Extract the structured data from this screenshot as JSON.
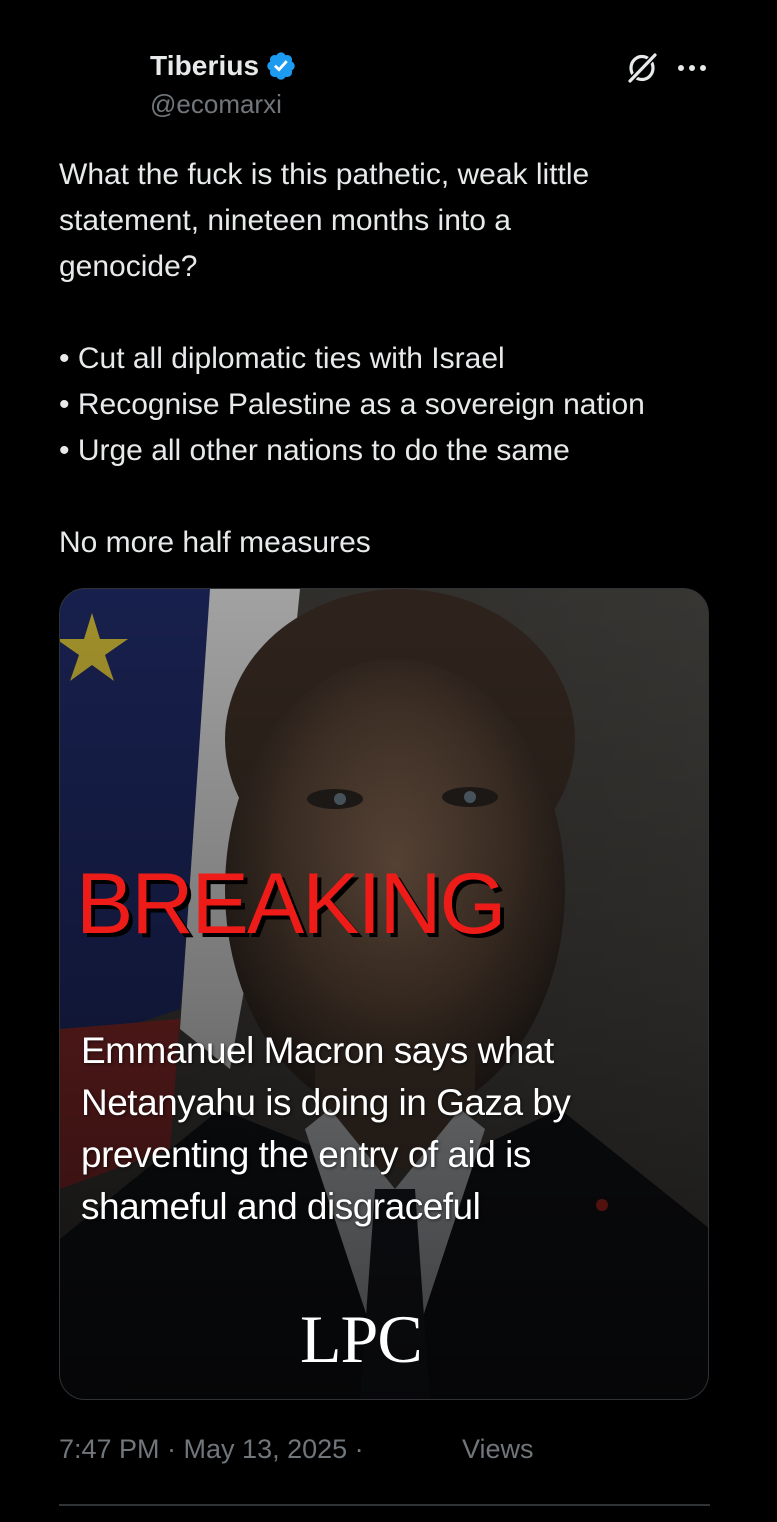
{
  "author": {
    "name": "Tiberius",
    "handle": "@ecomarxi",
    "verified": true,
    "verified_color": "#1d9bf0"
  },
  "icons": {
    "verified": "verified-badge-icon",
    "grok": "grok-icon",
    "more": "more-options-icon"
  },
  "tweet": {
    "lines": [
      "What the fuck is this pathetic, weak little",
      "statement, nineteen months into a",
      "genocide?",
      "• Cut all diplomatic ties with Israel",
      "• Recognise Palestine as a sovereign nation",
      "• Urge all other nations to do the same",
      "No more half measures"
    ]
  },
  "media": {
    "breaking": "BREAKING",
    "headline_lines": [
      "Emmanuel Macron says what",
      "Netanyahu is doing in Gaza by",
      "preventing the entry of aid is",
      "shameful and disgraceful"
    ],
    "logo": "LPC",
    "breaking_color": "#ee1c18"
  },
  "meta": {
    "timestamp": "7:47 PM · May 13, 2025 ·",
    "views_label": "Views"
  }
}
